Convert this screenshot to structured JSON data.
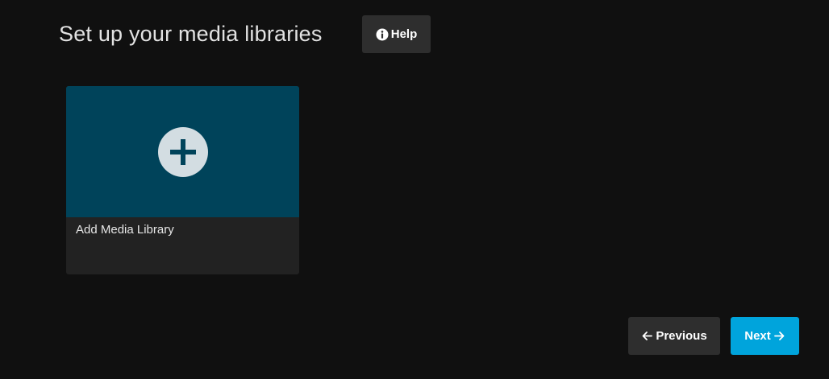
{
  "header": {
    "title": "Set up your media libraries",
    "help_label": "Help"
  },
  "library_card": {
    "label": "Add Media Library"
  },
  "footer": {
    "previous_label": "Previous",
    "next_label": "Next"
  },
  "icons": {
    "help": "info-circle-icon",
    "add": "plus-circle-icon",
    "previous": "arrow-left-icon",
    "next": "arrow-right-icon"
  },
  "colors": {
    "background": "#101010",
    "card_image": "#00435a",
    "card_body": "#222222",
    "secondary_button": "#2e2e2e",
    "accent": "#00a4dc",
    "plus_circle": "#d3dde2"
  }
}
